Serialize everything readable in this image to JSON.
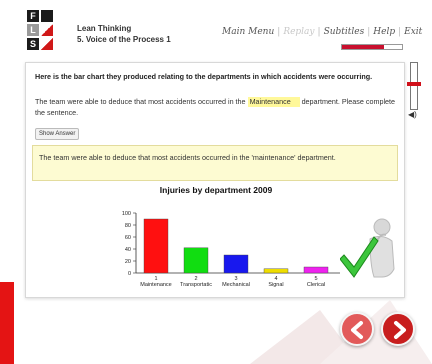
{
  "logo": {
    "letters": [
      "F",
      "L",
      "S"
    ],
    "colors": {
      "dark": "#1b1b1b",
      "red": "#d01818",
      "grey": "#9a9a9a"
    }
  },
  "header": {
    "course": "Lean Thinking",
    "lesson": "5. Voice of the Process 1",
    "nav": {
      "main_menu": "Main Menu",
      "replay": "Replay",
      "subtitles": "Subtitles",
      "help": "Help",
      "exit": "Exit"
    },
    "progress_fraction": 0.7
  },
  "content": {
    "question": "Here is the bar chart they produced relating to the departments in which accidents were occurring.",
    "instruction_before": "The team were able to deduce that most accidents occurred in the",
    "input_value": "Maintenance",
    "instruction_after": "department. Please complete the sentence.",
    "show_answer_label": "Show Answer",
    "answer_text": "The team were able to deduce that most accidents occurred in the 'maintenance' department."
  },
  "chart_data": {
    "type": "bar",
    "title": "Injuries by department 2009",
    "categories": [
      "1\nMaintenance",
      "2\nTransportatic",
      "3\nMechanical",
      "4\nSignal",
      "5\nClerical"
    ],
    "numbers": [
      "1",
      "2",
      "3",
      "4",
      "5"
    ],
    "names": [
      "Maintenance",
      "Transportatic",
      "Mechanical",
      "Signal",
      "Clerical"
    ],
    "values": [
      90,
      42,
      30,
      7,
      10
    ],
    "colors": [
      "#ff1010",
      "#11dd11",
      "#1818ee",
      "#eedd00",
      "#ee22ee"
    ],
    "ylim": [
      0,
      100
    ],
    "yticks": [
      "0",
      "20",
      "40",
      "60",
      "80",
      "100"
    ],
    "xlabel": "",
    "ylabel": ""
  },
  "controls": {
    "volume_icon": "speaker-icon",
    "prev_icon": "arrow-left-icon",
    "next_icon": "arrow-right-icon"
  }
}
